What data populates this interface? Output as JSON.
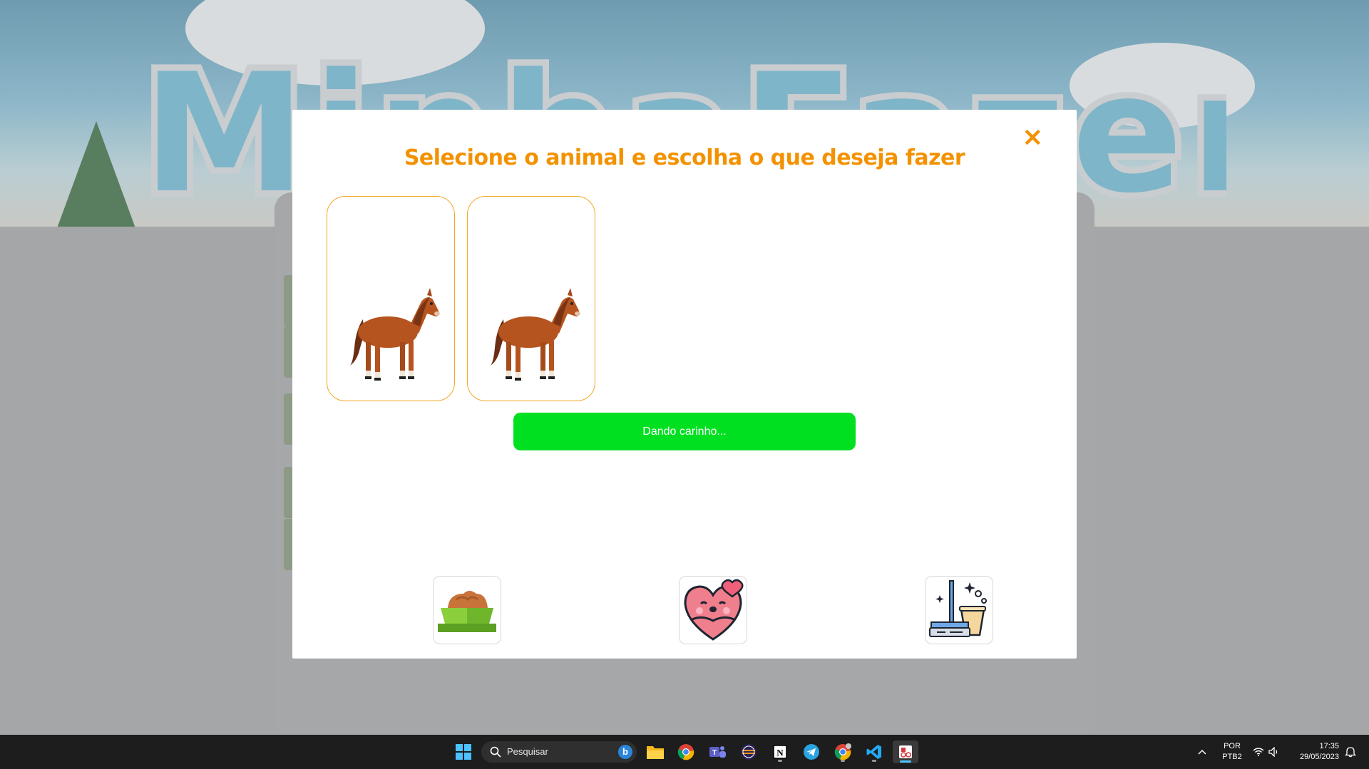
{
  "modal": {
    "title": "Selecione o animal e escolha o que deseja fazer",
    "close_symbol": "✕",
    "status_text": "Dando carinho...",
    "status_color": "#00e021",
    "accent_color": "#f39200",
    "animals": [
      {
        "icon": "horse-icon"
      },
      {
        "icon": "horse-icon"
      }
    ],
    "actions": [
      {
        "icon": "food-bowl-icon"
      },
      {
        "icon": "heart-hug-icon"
      },
      {
        "icon": "broom-bucket-icon"
      }
    ]
  },
  "taskbar": {
    "search_placeholder": "Pesquisar",
    "bing_letter": "b",
    "language_line1": "POR",
    "language_line2": "PTB2",
    "time": "17:35",
    "date": "29/05/2023",
    "apps": [
      "windows-start-icon",
      "file-explorer-icon",
      "chrome-icon",
      "teams-icon",
      "eclipse-icon",
      "notion-icon",
      "telegram-icon",
      "chrome-profile-icon",
      "vscode-icon",
      "snipping-tool-icon"
    ]
  }
}
